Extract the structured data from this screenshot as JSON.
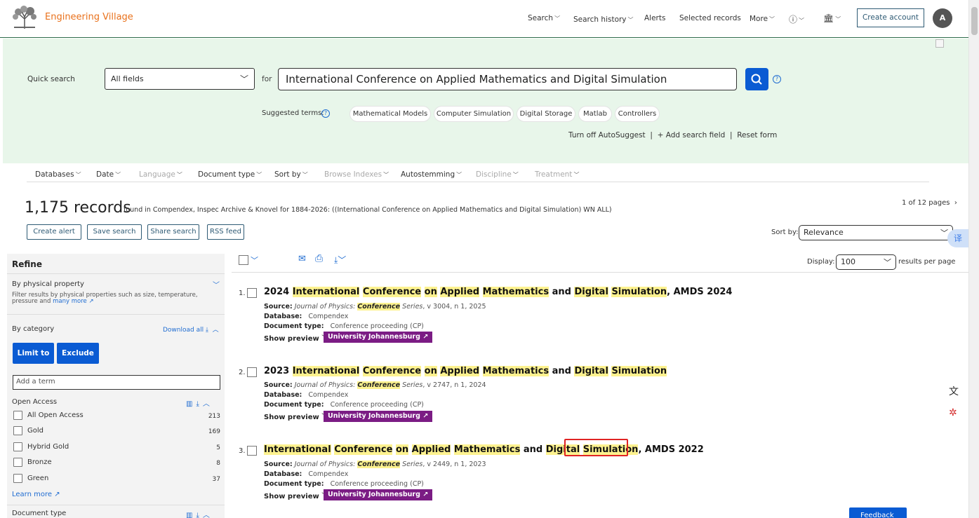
{
  "header": {
    "brand": "Engineering Village",
    "nav": [
      {
        "label": "Search"
      },
      {
        "label": "Search history"
      },
      {
        "label": "Alerts"
      },
      {
        "label": "Selected records"
      },
      {
        "label": "More"
      }
    ],
    "create_account": "Create account",
    "avatar_initial": "A"
  },
  "search": {
    "quick_label": "Quick search",
    "field": "All fields",
    "for_label": "for",
    "query": "International Conference on Applied Mathematics and Digital Simulation",
    "suggested_label": "Suggested terms:",
    "suggestions": [
      "Mathematical Models",
      "Computer Simulation",
      "Digital Storage",
      "Matlab",
      "Controllers"
    ],
    "links": {
      "autosuggest": "Turn off AutoSuggest",
      "add_field": "Add search field",
      "reset": "Reset form"
    }
  },
  "filters": [
    {
      "label": "Databases",
      "disabled": false
    },
    {
      "label": "Date",
      "disabled": false
    },
    {
      "label": "Language",
      "disabled": true
    },
    {
      "label": "Document type",
      "disabled": false
    },
    {
      "label": "Sort by",
      "disabled": false
    },
    {
      "label": "Browse Indexes",
      "disabled": true
    },
    {
      "label": "Autostemming",
      "disabled": false
    },
    {
      "label": "Discipline",
      "disabled": true
    },
    {
      "label": "Treatment",
      "disabled": true
    }
  ],
  "results_header": {
    "count": "1,175 records",
    "description": "found in Compendex, Inspec Archive & Knovel for 1884-2026: ((International Conference on Applied Mathematics and Digital Simulation) WN ALL)",
    "pages": "1 of 12 pages",
    "actions": [
      "Create alert",
      "Save search",
      "Share search",
      "RSS feed"
    ],
    "sort_label": "Sort by:",
    "sort_value": "Relevance",
    "display_label": "Display:",
    "display_value": "100",
    "per_page": "results per page"
  },
  "sidebar": {
    "title": "Refine",
    "physical_property": "By physical property",
    "physical_desc": "Filter results by physical properties such as size, temperature, pressure and",
    "many_more": "many more",
    "category": "By category",
    "download_all": "Download all",
    "limit_to": "Limit to",
    "exclude": "Exclude",
    "add_term_placeholder": "Add a term",
    "open_access": "Open Access",
    "oa_items": [
      {
        "label": "All Open Access",
        "count": "213"
      },
      {
        "label": "Gold",
        "count": "169"
      },
      {
        "label": "Hybrid Gold",
        "count": "5"
      },
      {
        "label": "Bronze",
        "count": "8"
      },
      {
        "label": "Green",
        "count": "37"
      }
    ],
    "learn_more": "Learn more",
    "document_type": "Document type"
  },
  "results": [
    {
      "num": "1.",
      "title_parts": [
        {
          "t": "2024 ",
          "hl": false
        },
        {
          "t": "International",
          "hl": true
        },
        {
          "t": " ",
          "hl": false
        },
        {
          "t": "Conference",
          "hl": true
        },
        {
          "t": " ",
          "hl": false
        },
        {
          "t": "on",
          "hl": true
        },
        {
          "t": " ",
          "hl": false
        },
        {
          "t": "Applied",
          "hl": true
        },
        {
          "t": " ",
          "hl": false
        },
        {
          "t": "Mathematics",
          "hl": true
        },
        {
          "t": " and ",
          "hl": false
        },
        {
          "t": "Digital",
          "hl": true
        },
        {
          "t": " ",
          "hl": false
        },
        {
          "t": "Simulation",
          "hl": true
        },
        {
          "t": ", AMDS 2024",
          "hl": false
        }
      ],
      "source_pre": "Journal of Physics: ",
      "source_kw": "Conference",
      "source_post": " Series",
      "source_vol": ", v 3004, n 1, 2025",
      "database": "Compendex",
      "doc_type": "Conference proceeding (CP)"
    },
    {
      "num": "2.",
      "title_parts": [
        {
          "t": "2023 ",
          "hl": false
        },
        {
          "t": "International",
          "hl": true
        },
        {
          "t": " ",
          "hl": false
        },
        {
          "t": "Conference",
          "hl": true
        },
        {
          "t": " ",
          "hl": false
        },
        {
          "t": "on",
          "hl": true
        },
        {
          "t": " ",
          "hl": false
        },
        {
          "t": "Applied",
          "hl": true
        },
        {
          "t": " ",
          "hl": false
        },
        {
          "t": "Mathematics",
          "hl": true
        },
        {
          "t": " and ",
          "hl": false
        },
        {
          "t": "Digital",
          "hl": true
        },
        {
          "t": " ",
          "hl": false
        },
        {
          "t": "Simulation",
          "hl": true
        }
      ],
      "source_pre": "Journal of Physics: ",
      "source_kw": "Conference",
      "source_post": " Series",
      "source_vol": ", v 2747, n 1, 2024",
      "database": "Compendex",
      "doc_type": "Conference proceeding (CP)"
    },
    {
      "num": "3.",
      "title_parts": [
        {
          "t": "International",
          "hl": true
        },
        {
          "t": " ",
          "hl": false
        },
        {
          "t": "Conference",
          "hl": true
        },
        {
          "t": " ",
          "hl": false
        },
        {
          "t": "on",
          "hl": true
        },
        {
          "t": " ",
          "hl": false
        },
        {
          "t": "Applied",
          "hl": true
        },
        {
          "t": " ",
          "hl": false
        },
        {
          "t": "Mathematics",
          "hl": true
        },
        {
          "t": " and ",
          "hl": false
        },
        {
          "t": "Digital",
          "hl": true
        },
        {
          "t": " ",
          "hl": false
        },
        {
          "t": "Simulation",
          "hl": true
        },
        {
          "t": ", AMDS 2022",
          "hl": false
        }
      ],
      "source_pre": "Journal of Physics: ",
      "source_kw": "Conference",
      "source_post": " Series",
      "source_vol": ", v 2449, n 1, 2023",
      "database": "Compendex",
      "doc_type": "Conference proceeding (CP)"
    }
  ],
  "result_labels": {
    "source": "Source:",
    "database": "Database:",
    "doc_type": "Document type:",
    "show_preview": "Show preview",
    "institution": "University Johannesburg"
  },
  "feedback": "Feedback",
  "colors": {
    "accent": "#0a5bd3",
    "brand": "#e9711c",
    "highlight": "#fdf28f",
    "badge": "#7b1c84",
    "panel": "#e8f6ea"
  }
}
